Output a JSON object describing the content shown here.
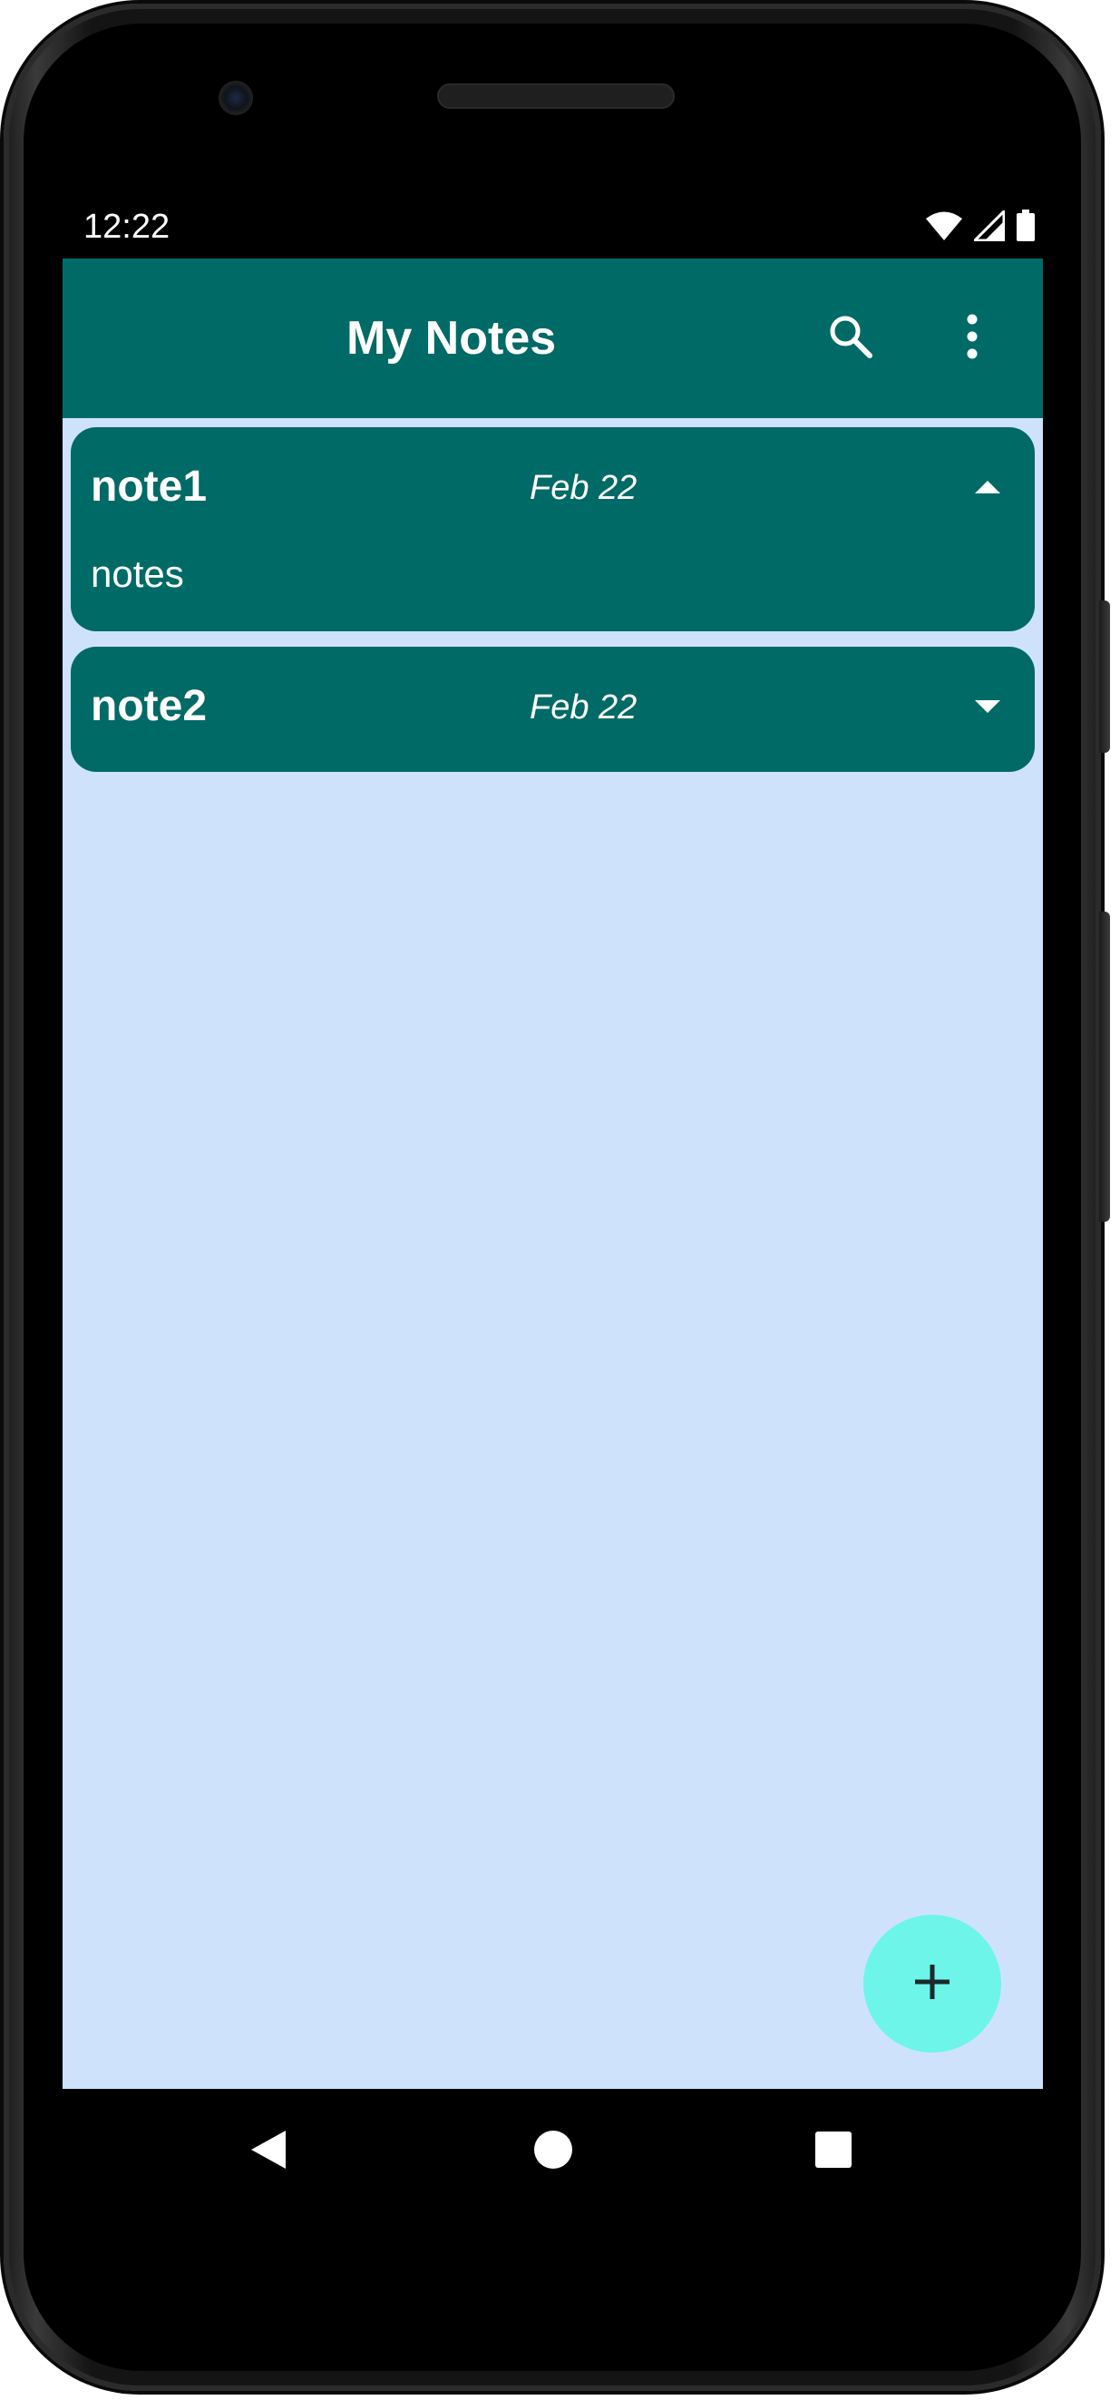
{
  "status_bar": {
    "time": "12:22",
    "icons": [
      "wifi-icon",
      "cellular-signal-icon",
      "battery-icon"
    ]
  },
  "app_bar": {
    "title": "My Notes",
    "actions": [
      "search-icon",
      "more-vert-icon"
    ]
  },
  "notes": [
    {
      "title": "note1",
      "date": "Feb 22",
      "body": "notes",
      "expanded": true,
      "toggle_icon": "chevron-up-icon"
    },
    {
      "title": "note2",
      "date": "Feb 22",
      "expanded": false,
      "toggle_icon": "chevron-down-icon"
    }
  ],
  "fab": {
    "icon": "plus-icon"
  },
  "navigation": {
    "buttons": [
      "back-icon",
      "home-icon",
      "recents-icon"
    ]
  },
  "colors": {
    "app_bar": "#006a66",
    "card": "#006a66",
    "background": "#cfe2fc",
    "fab": "#6df5ea",
    "text_on_primary": "#ffffff"
  }
}
